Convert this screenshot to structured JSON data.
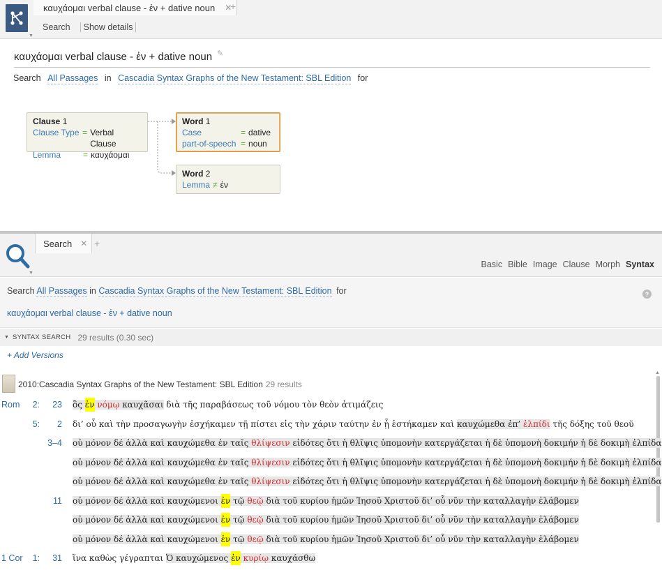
{
  "top": {
    "tab_title": "καυχάομαι verbal clause - ἐν + dative noun",
    "toolbar": {
      "search_label": "Search",
      "details_label": "Show details"
    },
    "query_title": "καυχάομαι verbal clause - ἐν + dative noun",
    "search_line": {
      "prefix": "Search",
      "passages": "All Passages",
      "in": "in",
      "resource": "Cascadia Syntax Graphs of the New Testament: SBL Edition",
      "for": "for"
    },
    "nodes": {
      "clause": {
        "type": "Clause",
        "index": "1",
        "rows": [
          {
            "key": "Clause Type",
            "op": "=",
            "val": "Verbal Clause"
          },
          {
            "key": "Lemma",
            "op": "=",
            "val": "καυχάομαι"
          }
        ]
      },
      "word1": {
        "type": "Word",
        "index": "1",
        "rows": [
          {
            "key": "Case",
            "op": "=",
            "val": "dative"
          },
          {
            "key": "part-of-speech",
            "op": "=",
            "val": "noun"
          }
        ]
      },
      "word2": {
        "type": "Word",
        "index": "2",
        "rows": [
          {
            "key": "Lemma",
            "op": "≠",
            "val": "ἐν"
          }
        ]
      }
    }
  },
  "bottom": {
    "tab_title": "Search",
    "view_tabs": [
      "Basic",
      "Bible",
      "Image",
      "Clause",
      "Morph",
      "Syntax"
    ],
    "active_view": "Syntax",
    "search_line": {
      "prefix": "Search",
      "passages": "All Passages",
      "in": "in",
      "resource": "Cascadia Syntax Graphs of the New Testament: SBL Edition",
      "for": "for"
    },
    "query": "καυχάομαι verbal clause - ἐν + dative noun",
    "help": "?",
    "syntax_label": "SYNTAX SEARCH",
    "syntax_count": "29 results (0.30 sec)",
    "add_versions": "+ Add Versions",
    "version": {
      "name": "2010:Cascadia Syntax Graphs of the New Testament: SBL Edition",
      "count": "29 results"
    },
    "results": [
      {
        "book": "Rom",
        "chap": "2:",
        "verse": "23",
        "segs": [
          {
            "t": "ὃς ",
            "s": "shade"
          },
          {
            "t": "ἐν",
            "s": "hl"
          },
          {
            "t": " ",
            "s": "shade"
          },
          {
            "t": "νόμῳ",
            "s": "red"
          },
          {
            "t": " καυχᾶσαι",
            "s": "shade"
          },
          {
            "t": " διὰ τῆς παραβάσεως τοῦ νόμου τὸν θεὸν ἀτιμάζεις",
            "s": ""
          }
        ]
      },
      {
        "book": "",
        "chap": "5:",
        "verse": "2",
        "segs": [
          {
            "t": "δι’ οὗ καὶ τὴν προσαγωγὴν ἐσχήκαμεν τῇ πίστει εἰς τὴν χάριν ταύτην ἐν ᾗ ἑστήκαμεν καὶ ",
            "s": ""
          },
          {
            "t": "καυχώμεθα ἐπ’ ",
            "s": "shade"
          },
          {
            "t": "ἐλπίδι",
            "s": "red"
          },
          {
            "t": " τῆς δόξης τοῦ θεοῦ",
            "s": ""
          }
        ]
      },
      {
        "book": "",
        "chap": "",
        "verse": "3–4",
        "segs": [
          {
            "t": "οὐ μόνον δέ ἀλλὰ καὶ καυχώμεθα ἐν ταῖς ",
            "s": "shade"
          },
          {
            "t": "θλίψεσιν",
            "s": "red"
          },
          {
            "t": " εἰδότες ὅτι ἡ θλῖψις ὑπομονὴν κατεργάζεται ἡ δὲ ὑπομονὴ δοκιμήν ἡ δὲ δοκιμὴ ἐλπίδα",
            "s": "shade"
          }
        ]
      },
      {
        "book": "",
        "chap": "",
        "verse": "",
        "segs": [
          {
            "t": "οὐ μόνον δέ ἀλλὰ καὶ καυχώμεθα ἐν ταῖς ",
            "s": "shade"
          },
          {
            "t": "θλίψεσιν",
            "s": "red"
          },
          {
            "t": " εἰδότες ὅτι ἡ θλῖψις ὑπομονὴν κατεργάζεται ἡ δὲ ὑπομονὴ δοκιμήν ἡ δὲ δοκιμὴ ἐλπίδα",
            "s": "shade"
          }
        ]
      },
      {
        "book": "",
        "chap": "",
        "verse": "",
        "segs": [
          {
            "t": "οὐ μόνον δέ ἀλλὰ καὶ καυχώμεθα ἐν ταῖς ",
            "s": "shade"
          },
          {
            "t": "θλίψεσιν",
            "s": "red"
          },
          {
            "t": " εἰδότες ὅτι ἡ θλῖψις ὑπομονὴν κατεργάζεται ἡ δὲ ὑπομονὴ δοκιμήν ἡ δὲ δοκιμὴ ἐλπίδα",
            "s": "shade"
          }
        ]
      },
      {
        "book": "",
        "chap": "",
        "verse": "11",
        "segs": [
          {
            "t": "οὐ μόνον δέ ἀλλὰ καὶ καυχώμενοι ",
            "s": "shade"
          },
          {
            "t": "ἐν",
            "s": "hl"
          },
          {
            "t": " τῷ ",
            "s": "shade"
          },
          {
            "t": "θεῷ",
            "s": "red"
          },
          {
            "t": " διὰ τοῦ κυρίου ἡμῶν Ἰησοῦ Χριστοῦ δι’ οὗ νῦν τὴν καταλλαγὴν ἐλάβομεν",
            "s": "shade"
          }
        ]
      },
      {
        "book": "",
        "chap": "",
        "verse": "",
        "segs": [
          {
            "t": "οὐ μόνον δέ ἀλλὰ καὶ καυχώμενοι ",
            "s": "shade"
          },
          {
            "t": "ἐν",
            "s": "hl"
          },
          {
            "t": " τῷ ",
            "s": "shade"
          },
          {
            "t": "θεῷ",
            "s": "red"
          },
          {
            "t": " διὰ τοῦ κυρίου ἡμῶν Ἰησοῦ Χριστοῦ δι’ οὗ νῦν τὴν καταλλαγὴν ἐλάβομεν",
            "s": "shade"
          }
        ]
      },
      {
        "book": "",
        "chap": "",
        "verse": "",
        "segs": [
          {
            "t": "οὐ μόνον δέ ἀλλὰ καὶ καυχώμενοι ",
            "s": "shade"
          },
          {
            "t": "ἐν",
            "s": "hl"
          },
          {
            "t": " τῷ ",
            "s": "shade"
          },
          {
            "t": "θεῷ",
            "s": "red"
          },
          {
            "t": " διὰ τοῦ κυρίου ἡμῶν Ἰησοῦ Χριστοῦ δι’ οὗ νῦν τὴν καταλλαγὴν ἐλάβομεν",
            "s": "shade"
          }
        ]
      },
      {
        "book": "1 Cor",
        "chap": "1:",
        "verse": "31",
        "segs": [
          {
            "t": "ἵνα καθὼς γέγραπται ",
            "s": ""
          },
          {
            "t": "Ὁ καυχώμενος ",
            "s": "shade"
          },
          {
            "t": "ἐν",
            "s": "hl"
          },
          {
            "t": " ",
            "s": "shade"
          },
          {
            "t": "κυρίῳ",
            "s": "red"
          },
          {
            "t": " καυχάσθω",
            "s": "shade"
          }
        ]
      }
    ]
  },
  "colors": {
    "link": "#2d6aa6",
    "highlight": "#ffff00",
    "match_red": "#d12c2c",
    "selected_border": "#d9953c",
    "icon_bg": "#3a5a82"
  },
  "icons": {
    "app": "syntax-graph-icon",
    "search": "magnifier-icon",
    "close": "close-icon",
    "add": "plus-icon"
  }
}
